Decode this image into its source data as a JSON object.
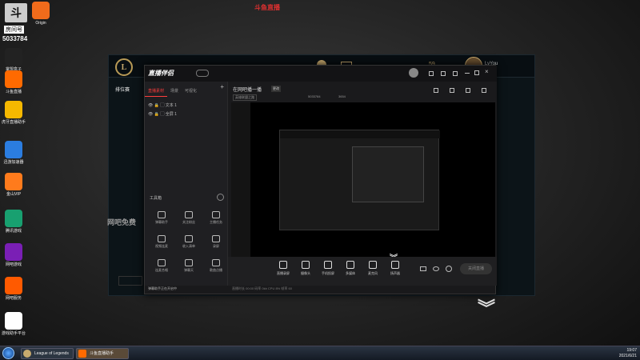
{
  "watermark": "斗鱼直播",
  "room": {
    "label": "房间号",
    "number": "5033784"
  },
  "desktop_icons": [
    {
      "name": "Origin",
      "label": "Origin",
      "color": "#f06b1b"
    },
    {
      "name": "lol-box",
      "label": "掌盟盒子",
      "color": "#222"
    },
    {
      "name": "douyu",
      "label": "斗鱼直播",
      "color": "#ff6a00"
    },
    {
      "name": "hupu",
      "label": "虎牙直播助手",
      "color": "#f6b800"
    },
    {
      "name": "xunyou",
      "label": "迅游加速器",
      "color": "#2b7de0"
    },
    {
      "name": "vip",
      "label": "金山VIP",
      "color": "#ff7b1c"
    },
    {
      "name": "tencent",
      "label": "腾讯游戏",
      "color": "#18a070"
    },
    {
      "name": "bar",
      "label": "网吧游戏",
      "color": "#7a1fb5"
    },
    {
      "name": "netbar",
      "label": "网吧服务",
      "color": "#ff5a00"
    },
    {
      "name": "game-assist",
      "label": "游戏助手平台",
      "color": "#fff"
    }
  ],
  "lol": {
    "logo": "L",
    "nav": [
      "排位赛"
    ],
    "level": "59",
    "user": "LyYou",
    "side_text": [
      "网吧免费",
      "英雄"
    ]
  },
  "companion": {
    "title": "直播伴侣",
    "tabs": [
      "直播素材",
      "场景",
      "可视化"
    ],
    "sources": [
      "文本 1",
      "全屏 1"
    ],
    "tools_title": "工具箱",
    "tools": [
      "弹幕助手",
      "关注粉丝",
      "主播任务",
      "视频连麦",
      "收入清单",
      "录屏",
      "连麦合唱",
      "弹幕天",
      "歌曲点播"
    ],
    "room_title": "在网吧播一播",
    "room_badge": "更改",
    "category": "英雄联盟之路",
    "room_id": "5033784",
    "viewers": "3654",
    "bottom": [
      "直播录屏",
      "摄像头",
      "手机投屏",
      "多媒体",
      "麦克风",
      "扬声器"
    ],
    "stop_btn": "关闭直播",
    "footer": "弹幕助手正在开启中",
    "status": "直播时长 00:00 码率 0kb CPU 8% 帧率 60"
  },
  "taskbar": {
    "tasks": [
      "League of Legends",
      "斗鱼直播助手"
    ],
    "time": "19:07",
    "date": "2021/6/21"
  }
}
